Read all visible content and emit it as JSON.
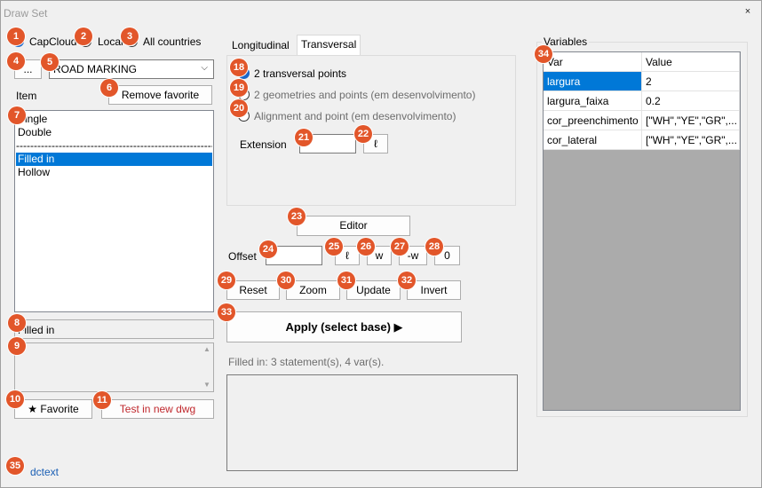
{
  "window": {
    "title": "Draw Set",
    "close_glyph": "×"
  },
  "source": {
    "options": [
      {
        "label": "CapCloud",
        "checked": true
      },
      {
        "label": "Local",
        "checked": false
      },
      {
        "label": "All countries",
        "checked": false
      }
    ]
  },
  "browse_button": "...",
  "category_select": {
    "value": "ROAD MARKING",
    "chevron": "⌵"
  },
  "item_label": "Item",
  "remove_favorite": "Remove favorite",
  "items": [
    {
      "label": "Single",
      "selected": false
    },
    {
      "label": "Double",
      "selected": false
    },
    {
      "label": "----------------------------------------------------------------",
      "separator": true
    },
    {
      "label": "Filled in",
      "selected": true
    },
    {
      "label": "Hollow",
      "selected": false
    }
  ],
  "selected_item_text": "Filled in",
  "scroll_up": "▲",
  "scroll_down": "▼",
  "favorite_button": "★ Favorite",
  "test_button": "Test in new dwg",
  "footer_link": "dctext",
  "tabs": [
    {
      "label": "Longitudinal",
      "active": false
    },
    {
      "label": "Transversal",
      "active": true
    }
  ],
  "transversal": {
    "options": [
      {
        "label": "2 transversal points",
        "checked": true,
        "enabled": true
      },
      {
        "label": "2 geometries and points (em desenvolvimento)",
        "checked": false,
        "enabled": false
      },
      {
        "label": "Alignment and point (em desenvolvimento)",
        "checked": false,
        "enabled": false
      }
    ],
    "extension_label": "Extension",
    "extension_value": "",
    "ell_button": "ℓ"
  },
  "editor_button": "Editor",
  "offset": {
    "label": "Offset",
    "value": "",
    "buttons": [
      "ℓ",
      "w",
      "-w",
      "0"
    ]
  },
  "actions": [
    "Reset",
    "Zoom",
    "Update",
    "Invert"
  ],
  "apply_button": "Apply (select base) ▶",
  "status_text": "Filled in: 3 statement(s), 4 var(s).",
  "variables": {
    "group_label": "Variables",
    "columns": [
      "Var",
      "Value"
    ],
    "rows": [
      {
        "var": "largura",
        "value": "2"
      },
      {
        "var": "largura_faixa",
        "value": "0.2"
      },
      {
        "var": "cor_preenchimento",
        "value": "[\"WH\",\"YE\",\"GR\",..."
      },
      {
        "var": "cor_lateral",
        "value": "[\"WH\",\"YE\",\"GR\",..."
      }
    ]
  },
  "badges": [
    "1",
    "2",
    "3",
    "4",
    "5",
    "6",
    "7",
    "8",
    "9",
    "10",
    "11",
    "18",
    "19",
    "20",
    "21",
    "22",
    "23",
    "24",
    "25",
    "26",
    "27",
    "28",
    "29",
    "30",
    "31",
    "32",
    "33",
    "34",
    "35"
  ],
  "colors": {
    "badge": "#e2562a",
    "selection": "#0078d7",
    "accent_red": "#c0282d",
    "link": "#1a5fb4"
  }
}
